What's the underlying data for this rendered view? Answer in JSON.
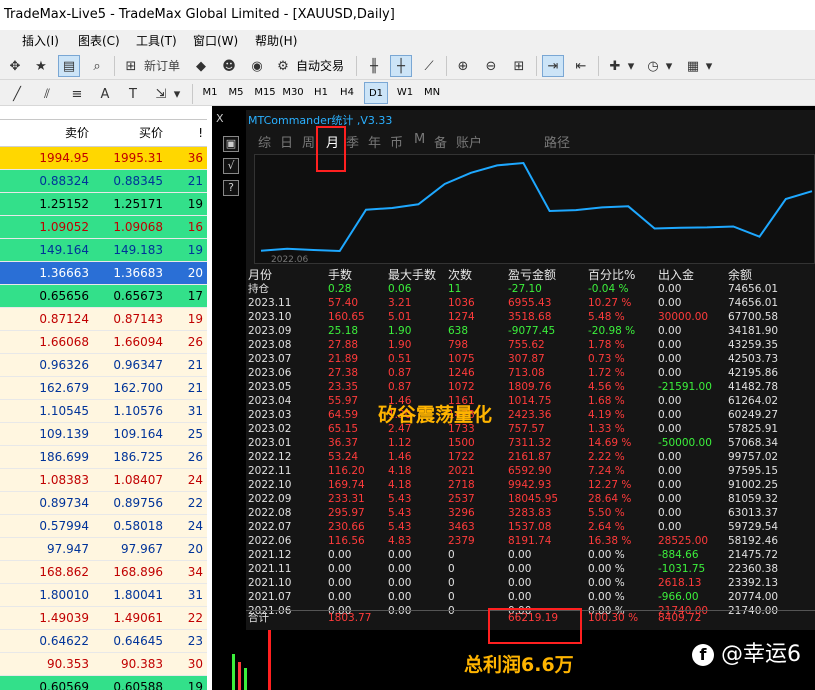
{
  "window": {
    "title": "TradeMax-Live5 - TradeMax Global Limited - [XAUUSD,Daily]"
  },
  "menu": [
    "插入(I)",
    "图表(C)",
    "工具(T)",
    "窗口(W)",
    "帮助(H)"
  ],
  "toolbar": {
    "new_order": "新订单",
    "auto_trade": "自动交易"
  },
  "timeframes": [
    "M1",
    "M5",
    "M15",
    "M30",
    "H1",
    "H4",
    "D1",
    "W1",
    "MN"
  ],
  "active_timeframe": "D1",
  "market_watch": {
    "headers": {
      "bid": "卖价",
      "ask": "买价",
      "spread": "!"
    },
    "rows": [
      {
        "bid": "1994.95",
        "ask": "1995.31",
        "spread": "36",
        "bg": "#ffd700",
        "fg": "#c00000"
      },
      {
        "bid": "0.88324",
        "ask": "0.88345",
        "spread": "21",
        "bg": "#33e08a",
        "fg": "#003399"
      },
      {
        "bid": "1.25152",
        "ask": "1.25171",
        "spread": "19",
        "bg": "#33e08a",
        "fg": "#000000"
      },
      {
        "bid": "1.09052",
        "ask": "1.09068",
        "spread": "16",
        "bg": "#33e08a",
        "fg": "#c00000"
      },
      {
        "bid": "149.164",
        "ask": "149.183",
        "spread": "19",
        "bg": "#33e08a",
        "fg": "#003399"
      },
      {
        "bid": "1.36663",
        "ask": "1.36683",
        "spread": "20",
        "bg": "#2a6fd6",
        "fg": "#ffffff"
      },
      {
        "bid": "0.65656",
        "ask": "0.65673",
        "spread": "17",
        "bg": "#33e08a",
        "fg": "#000000"
      },
      {
        "bid": "0.87124",
        "ask": "0.87143",
        "spread": "19",
        "bg": "#fff6e0",
        "fg": "#c00000"
      },
      {
        "bid": "1.66068",
        "ask": "1.66094",
        "spread": "26",
        "bg": "#fff6e0",
        "fg": "#c00000"
      },
      {
        "bid": "0.96326",
        "ask": "0.96347",
        "spread": "21",
        "bg": "#fff6e0",
        "fg": "#003399"
      },
      {
        "bid": "162.679",
        "ask": "162.700",
        "spread": "21",
        "bg": "#fff6e0",
        "fg": "#003399"
      },
      {
        "bid": "1.10545",
        "ask": "1.10576",
        "spread": "31",
        "bg": "#fff6e0",
        "fg": "#003399"
      },
      {
        "bid": "109.139",
        "ask": "109.164",
        "spread": "25",
        "bg": "#fff6e0",
        "fg": "#003399"
      },
      {
        "bid": "186.699",
        "ask": "186.725",
        "spread": "26",
        "bg": "#fff6e0",
        "fg": "#003399"
      },
      {
        "bid": "1.08383",
        "ask": "1.08407",
        "spread": "24",
        "bg": "#fff6e0",
        "fg": "#c00000"
      },
      {
        "bid": "0.89734",
        "ask": "0.89756",
        "spread": "22",
        "bg": "#fff6e0",
        "fg": "#003399"
      },
      {
        "bid": "0.57994",
        "ask": "0.58018",
        "spread": "24",
        "bg": "#fff6e0",
        "fg": "#003399"
      },
      {
        "bid": "97.947",
        "ask": "97.967",
        "spread": "20",
        "bg": "#fff6e0",
        "fg": "#003399"
      },
      {
        "bid": "168.862",
        "ask": "168.896",
        "spread": "34",
        "bg": "#fff6e0",
        "fg": "#c00000"
      },
      {
        "bid": "1.80010",
        "ask": "1.80041",
        "spread": "31",
        "bg": "#fff6e0",
        "fg": "#003399"
      },
      {
        "bid": "1.49039",
        "ask": "1.49061",
        "spread": "22",
        "bg": "#fff6e0",
        "fg": "#c00000"
      },
      {
        "bid": "0.64622",
        "ask": "0.64645",
        "spread": "23",
        "bg": "#fff6e0",
        "fg": "#003399"
      },
      {
        "bid": "90.353",
        "ask": "90.383",
        "spread": "30",
        "bg": "#fff6e0",
        "fg": "#c00000"
      },
      {
        "bid": "0.60569",
        "ask": "0.60588",
        "spread": "19",
        "bg": "#33e08a",
        "fg": "#000000"
      }
    ]
  },
  "stats_panel": {
    "title": "MTCommander统计 ,V3.33",
    "close_label": "X",
    "tabs": [
      "综",
      "日",
      "周",
      "月",
      "季",
      "年",
      "币",
      "M",
      "备",
      "账户",
      "路径"
    ],
    "active_tab": "月",
    "graph_start_label": "2022.06",
    "curve_values": [
      21740,
      23392,
      22360,
      21475,
      58192,
      59729,
      63013,
      81059,
      91002,
      97595,
      99757,
      57068,
      57825,
      60249,
      61264,
      41482,
      42195,
      42503,
      43259,
      34181,
      67700,
      74656
    ],
    "columns": [
      "月份",
      "手数",
      "最大手数",
      "次数",
      "盈亏金额",
      "百分比%",
      "出入金",
      "余额"
    ],
    "rows": [
      {
        "month": "持仓",
        "lots": "0.28",
        "max_lots": "0.06",
        "trades": "11",
        "pnl": "-27.10",
        "pct": "-0.04 %",
        "flow": "0.00",
        "balance": "74656.01",
        "tone": "green"
      },
      {
        "month": "2023.11",
        "lots": "57.40",
        "max_lots": "3.21",
        "trades": "1036",
        "pnl": "6955.43",
        "pct": "10.27 %",
        "flow": "0.00",
        "balance": "74656.01",
        "tone": "red"
      },
      {
        "month": "2023.10",
        "lots": "160.65",
        "max_lots": "5.01",
        "trades": "1274",
        "pnl": "3518.68",
        "pct": "5.48 %",
        "flow": "30000.00",
        "balance": "67700.58",
        "tone": "red"
      },
      {
        "month": "2023.09",
        "lots": "25.18",
        "max_lots": "1.90",
        "trades": "638",
        "pnl": "-9077.45",
        "pct": "-20.98 %",
        "flow": "0.00",
        "balance": "34181.90",
        "tone": "green"
      },
      {
        "month": "2023.08",
        "lots": "27.88",
        "max_lots": "1.90",
        "trades": "798",
        "pnl": "755.62",
        "pct": "1.78 %",
        "flow": "0.00",
        "balance": "43259.35",
        "tone": "red"
      },
      {
        "month": "2023.07",
        "lots": "21.89",
        "max_lots": "0.51",
        "trades": "1075",
        "pnl": "307.87",
        "pct": "0.73 %",
        "flow": "0.00",
        "balance": "42503.73",
        "tone": "red"
      },
      {
        "month": "2023.06",
        "lots": "27.38",
        "max_lots": "0.87",
        "trades": "1246",
        "pnl": "713.08",
        "pct": "1.72 %",
        "flow": "0.00",
        "balance": "42195.86",
        "tone": "red"
      },
      {
        "month": "2023.05",
        "lots": "23.35",
        "max_lots": "0.87",
        "trades": "1072",
        "pnl": "1809.76",
        "pct": "4.56 %",
        "flow": "-21591.00",
        "balance": "41482.78",
        "tone": "red"
      },
      {
        "month": "2023.04",
        "lots": "55.97",
        "max_lots": "1.46",
        "trades": "1161",
        "pnl": "1014.75",
        "pct": "1.68 %",
        "flow": "0.00",
        "balance": "61264.02",
        "tone": "red"
      },
      {
        "month": "2023.03",
        "lots": "64.59",
        "max_lots": "1.30",
        "trades": "1478",
        "pnl": "2423.36",
        "pct": "4.19 %",
        "flow": "0.00",
        "balance": "60249.27",
        "tone": "red"
      },
      {
        "month": "2023.02",
        "lots": "65.15",
        "max_lots": "2.47",
        "trades": "1733",
        "pnl": "757.57",
        "pct": "1.33 %",
        "flow": "0.00",
        "balance": "57825.91",
        "tone": "red"
      },
      {
        "month": "2023.01",
        "lots": "36.37",
        "max_lots": "1.12",
        "trades": "1500",
        "pnl": "7311.32",
        "pct": "14.69 %",
        "flow": "-50000.00",
        "balance": "57068.34",
        "tone": "red"
      },
      {
        "month": "2022.12",
        "lots": "53.24",
        "max_lots": "1.46",
        "trades": "1722",
        "pnl": "2161.87",
        "pct": "2.22 %",
        "flow": "0.00",
        "balance": "99757.02",
        "tone": "red"
      },
      {
        "month": "2022.11",
        "lots": "116.20",
        "max_lots": "4.18",
        "trades": "2021",
        "pnl": "6592.90",
        "pct": "7.24 %",
        "flow": "0.00",
        "balance": "97595.15",
        "tone": "red"
      },
      {
        "month": "2022.10",
        "lots": "169.74",
        "max_lots": "4.18",
        "trades": "2718",
        "pnl": "9942.93",
        "pct": "12.27 %",
        "flow": "0.00",
        "balance": "91002.25",
        "tone": "red"
      },
      {
        "month": "2022.09",
        "lots": "233.31",
        "max_lots": "5.43",
        "trades": "2537",
        "pnl": "18045.95",
        "pct": "28.64 %",
        "flow": "0.00",
        "balance": "81059.32",
        "tone": "red"
      },
      {
        "month": "2022.08",
        "lots": "295.97",
        "max_lots": "5.43",
        "trades": "3296",
        "pnl": "3283.83",
        "pct": "5.50 %",
        "flow": "0.00",
        "balance": "63013.37",
        "tone": "red"
      },
      {
        "month": "2022.07",
        "lots": "230.66",
        "max_lots": "5.43",
        "trades": "3463",
        "pnl": "1537.08",
        "pct": "2.64 %",
        "flow": "0.00",
        "balance": "59729.54",
        "tone": "red"
      },
      {
        "month": "2022.06",
        "lots": "116.56",
        "max_lots": "4.83",
        "trades": "2379",
        "pnl": "8191.74",
        "pct": "16.38 %",
        "flow": "28525.00",
        "balance": "58192.46",
        "tone": "red"
      },
      {
        "month": "2021.12",
        "lots": "0.00",
        "max_lots": "0.00",
        "trades": "0",
        "pnl": "0.00",
        "pct": "0.00 %",
        "flow": "-884.66",
        "balance": "21475.72",
        "tone": "white"
      },
      {
        "month": "2021.11",
        "lots": "0.00",
        "max_lots": "0.00",
        "trades": "0",
        "pnl": "0.00",
        "pct": "0.00 %",
        "flow": "-1031.75",
        "balance": "22360.38",
        "tone": "white"
      },
      {
        "month": "2021.10",
        "lots": "0.00",
        "max_lots": "0.00",
        "trades": "0",
        "pnl": "0.00",
        "pct": "0.00 %",
        "flow": "2618.13",
        "balance": "23392.13",
        "tone": "white"
      },
      {
        "month": "2021.07",
        "lots": "0.00",
        "max_lots": "0.00",
        "trades": "0",
        "pnl": "0.00",
        "pct": "0.00 %",
        "flow": "-966.00",
        "balance": "20774.00",
        "tone": "white"
      },
      {
        "month": "2021.06",
        "lots": "0.00",
        "max_lots": "0.00",
        "trades": "0",
        "pnl": "0.00",
        "pct": "0.00 %",
        "flow": "21740.00",
        "balance": "21740.00",
        "tone": "white"
      }
    ],
    "summary": {
      "label": "合计",
      "lots": "1803.77",
      "pnl": "66219.19",
      "pct": "100.30 %",
      "flow": "8409.72"
    }
  },
  "overlay": {
    "brand": "矽谷震荡量化",
    "profit_caption": "总利润6.6万",
    "watermark": "@幸运6"
  },
  "colors": {
    "red": "#ff3b3b",
    "green": "#3cf03c",
    "curve": "#1ea8ff",
    "highlight_box": "#ff2020",
    "caption": "#ffb400"
  }
}
